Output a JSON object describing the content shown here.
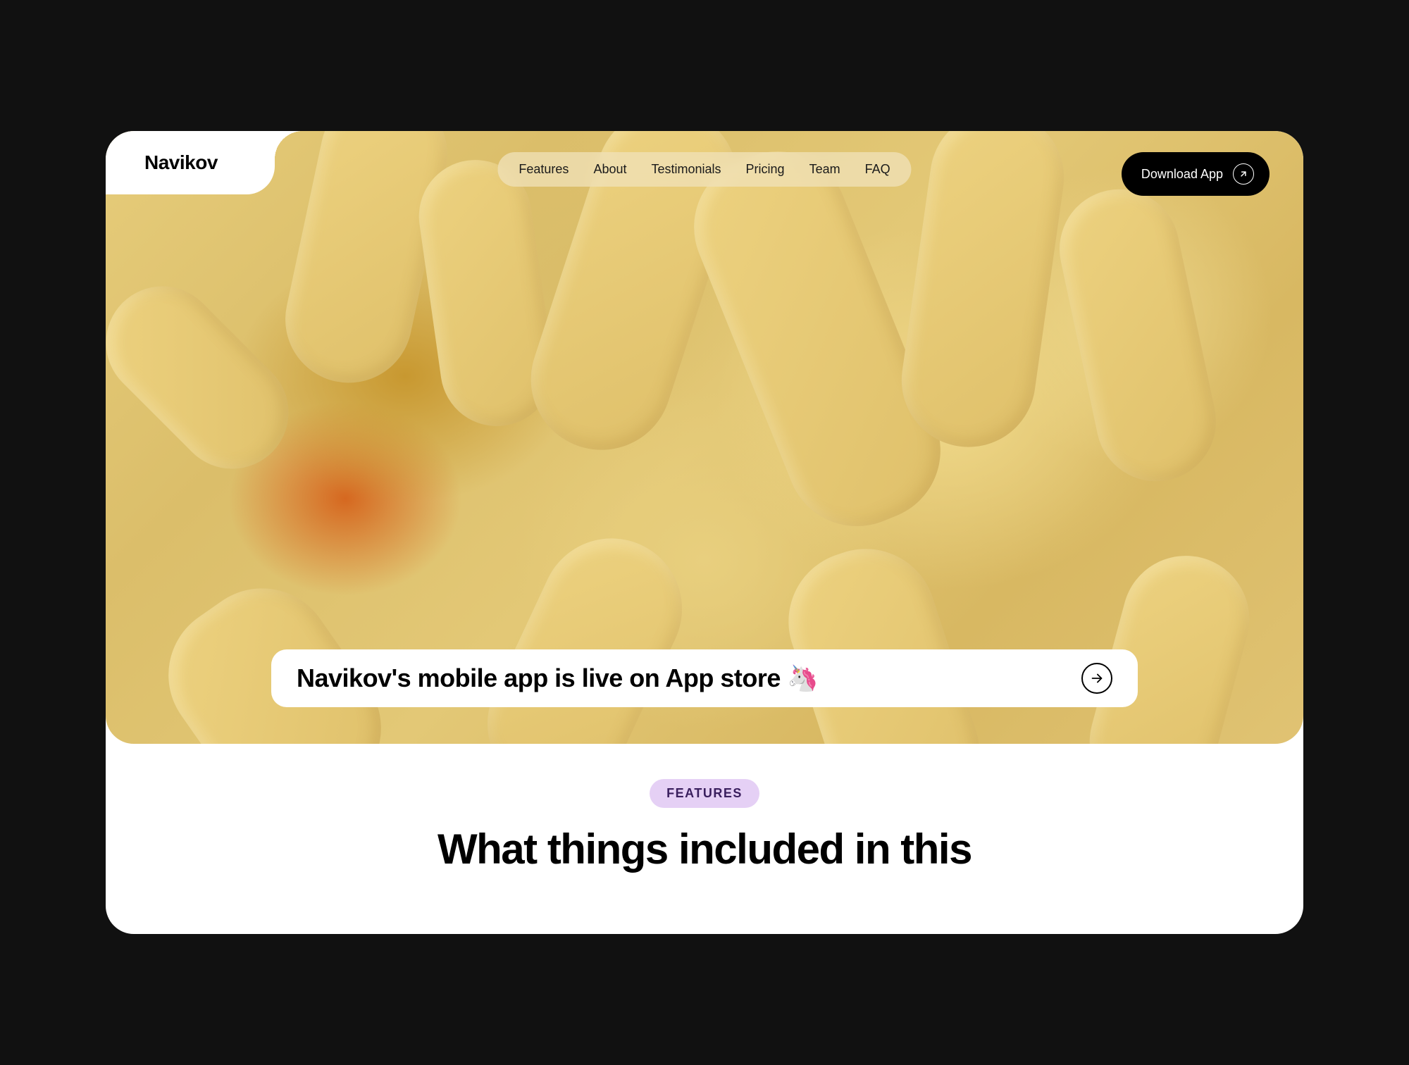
{
  "brand": {
    "name": "Navikov"
  },
  "nav": {
    "items": [
      {
        "label": "Features"
      },
      {
        "label": "About"
      },
      {
        "label": "Testimonials"
      },
      {
        "label": "Pricing"
      },
      {
        "label": "Team"
      },
      {
        "label": "FAQ"
      }
    ]
  },
  "cta": {
    "download_label": "Download App"
  },
  "announcement": {
    "text": "Navikov's mobile app is live on App store 🦄"
  },
  "features": {
    "badge": "FEATURES",
    "heading": "What things included in this"
  }
}
